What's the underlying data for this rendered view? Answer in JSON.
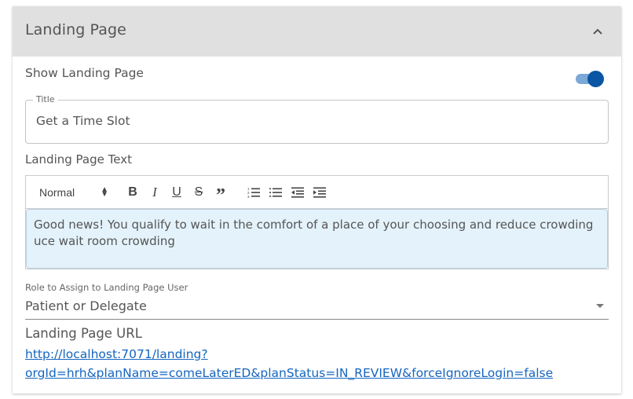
{
  "panel": {
    "title": "Landing Page",
    "collapse_icon": "chevron-up-icon",
    "expanded": true
  },
  "show_landing_page": {
    "label": "Show Landing Page",
    "enabled": true,
    "colors": {
      "track": "#7ba8d6",
      "thumb": "#0b56a4"
    }
  },
  "title_field": {
    "label": "Title",
    "value": "Get a Time Slot"
  },
  "landing_text": {
    "label": "Landing Page Text",
    "toolbar": {
      "format_value": "Normal",
      "buttons": [
        {
          "name": "bold",
          "glyph": "B",
          "icon": "bold-icon"
        },
        {
          "name": "italic",
          "glyph": "I",
          "icon": "italic-icon"
        },
        {
          "name": "underline",
          "glyph": "U",
          "icon": "underline-icon"
        },
        {
          "name": "strike",
          "glyph": "S",
          "icon": "strikethrough-icon"
        },
        {
          "name": "blockquote",
          "glyph": "”",
          "icon": "quote-icon"
        },
        {
          "name": "ordered-list",
          "icon": "ordered-list-icon"
        },
        {
          "name": "bullet-list",
          "icon": "bullet-list-icon"
        },
        {
          "name": "outdent",
          "icon": "outdent-icon"
        },
        {
          "name": "indent",
          "icon": "indent-icon"
        }
      ]
    },
    "content": "Good news! You qualify to wait in the comfort of a place of your choosing and reduce crowding uce wait room crowding",
    "content_bg": "#e3f2fb"
  },
  "role": {
    "label": "Role to Assign to Landing Page User",
    "value": "Patient or Delegate"
  },
  "landing_url": {
    "label": "Landing Page URL",
    "url": "http://localhost:7071/landing?orgId=hrh&planName=comeLaterED&planStatus=IN_REVIEW&forceIgnoreLogin=false",
    "line1": "http://localhost:7071/landing?",
    "line2": "orgId=hrh&planName=comeLaterED&planStatus=IN_REVIEW&forceIgnoreLogin=false",
    "color": "#1565c0"
  }
}
